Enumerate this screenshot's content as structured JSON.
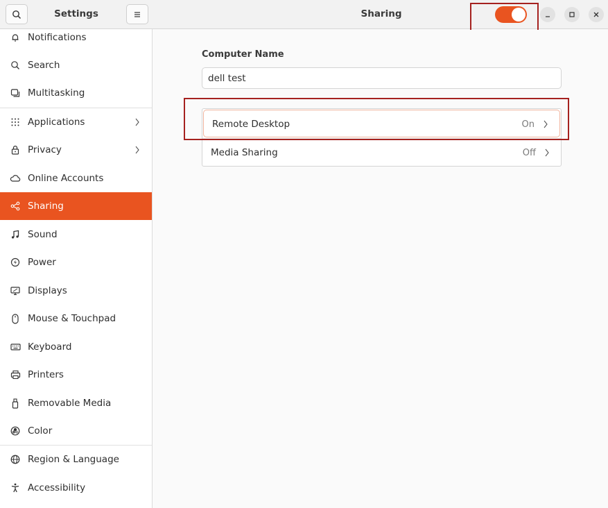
{
  "sidebar": {
    "title": "Settings",
    "items": [
      {
        "label": "Notifications",
        "icon": "bell-icon"
      },
      {
        "label": "Search",
        "icon": "search-icon"
      },
      {
        "label": "Multitasking",
        "icon": "multitasking-icon"
      },
      {
        "label": "Applications",
        "icon": "grid-icon",
        "has_submenu": true
      },
      {
        "label": "Privacy",
        "icon": "lock-icon",
        "has_submenu": true
      },
      {
        "label": "Online Accounts",
        "icon": "cloud-icon"
      },
      {
        "label": "Sharing",
        "icon": "share-icon",
        "active": true
      },
      {
        "label": "Sound",
        "icon": "music-note-icon"
      },
      {
        "label": "Power",
        "icon": "power-icon"
      },
      {
        "label": "Displays",
        "icon": "display-icon"
      },
      {
        "label": "Mouse & Touchpad",
        "icon": "mouse-icon"
      },
      {
        "label": "Keyboard",
        "icon": "keyboard-icon"
      },
      {
        "label": "Printers",
        "icon": "printer-icon"
      },
      {
        "label": "Removable Media",
        "icon": "usb-drive-icon"
      },
      {
        "label": "Color",
        "icon": "color-icon"
      },
      {
        "label": "Region & Language",
        "icon": "globe-icon"
      },
      {
        "label": "Accessibility",
        "icon": "accessibility-icon"
      }
    ]
  },
  "header": {
    "title": "Sharing",
    "sharing_toggle_on": true
  },
  "main": {
    "computer_name_label": "Computer Name",
    "computer_name_value": "dell test",
    "rows": [
      {
        "label": "Remote Desktop",
        "value": "On"
      },
      {
        "label": "Media Sharing",
        "value": "Off"
      }
    ]
  },
  "colors": {
    "accent": "#e95420",
    "highlight_box": "#a5211f"
  }
}
